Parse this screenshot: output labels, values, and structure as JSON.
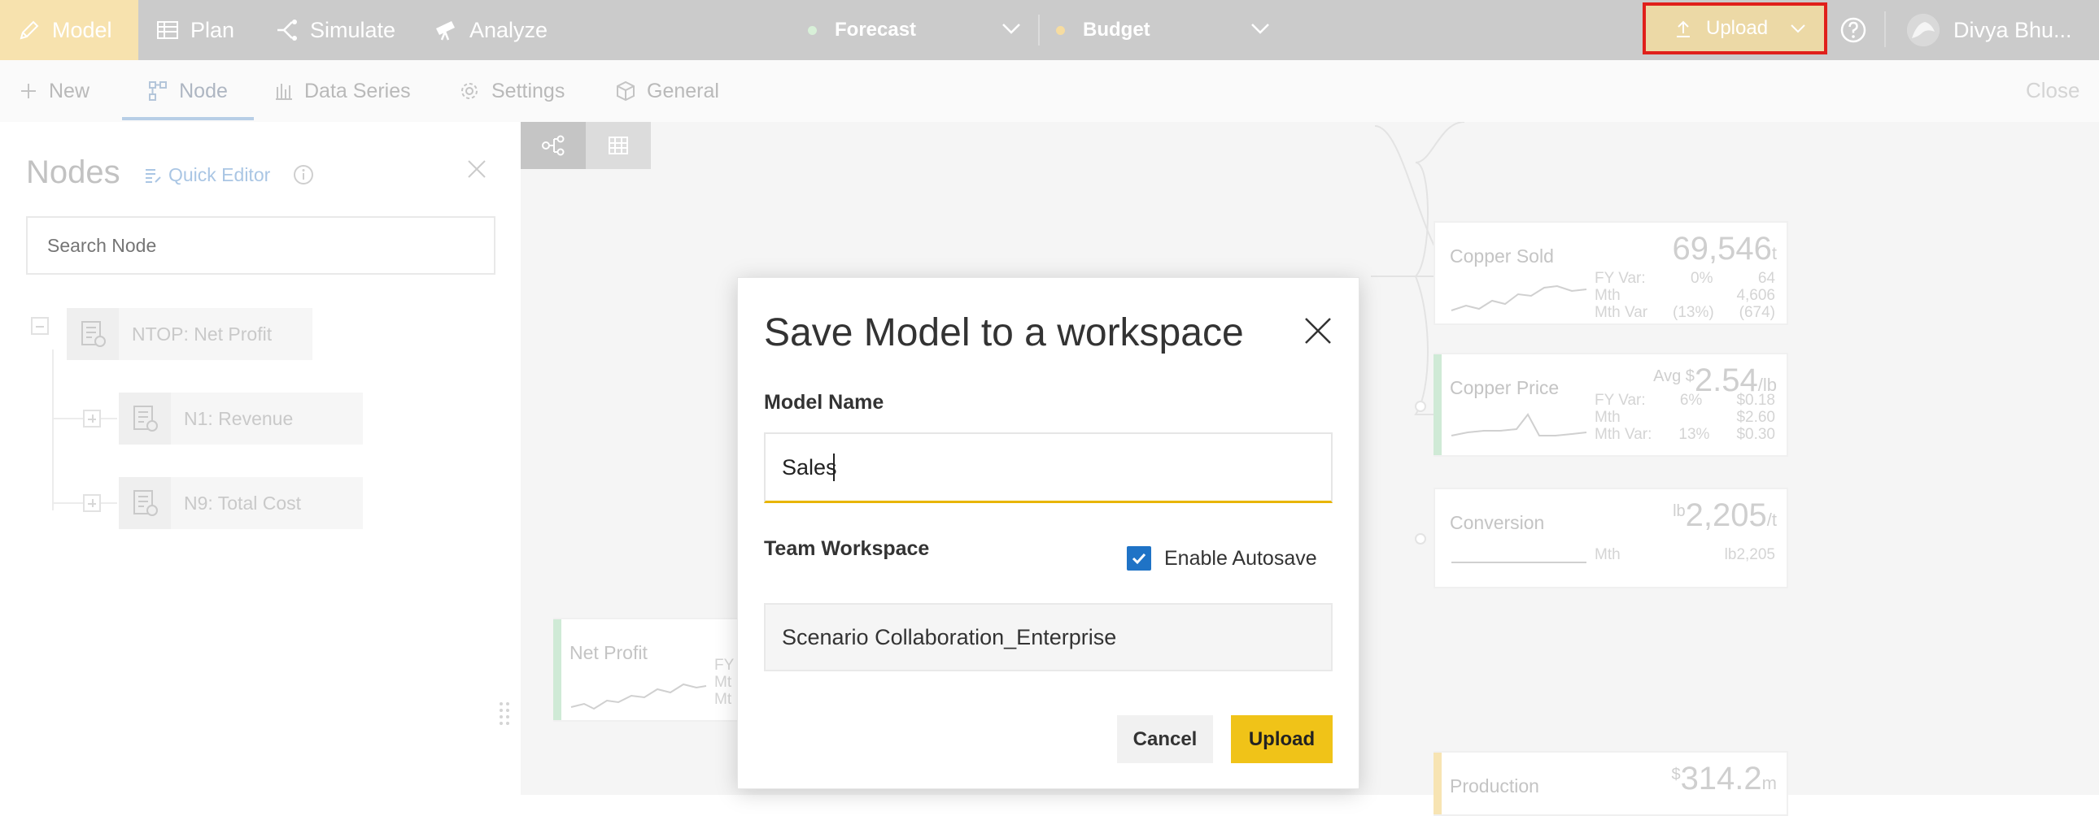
{
  "topbar": {
    "tabs": [
      {
        "label": "Model",
        "icon": "pencil-icon"
      },
      {
        "label": "Plan",
        "icon": "table-icon"
      },
      {
        "label": "Simulate",
        "icon": "branch-icon"
      },
      {
        "label": "Analyze",
        "icon": "telescope-icon"
      }
    ],
    "scenarios": [
      {
        "label": "Forecast",
        "dot_color": "#d8f0d8"
      },
      {
        "label": "Budget",
        "dot_color": "#f6dca0"
      }
    ],
    "upload_label": "Upload",
    "user_name": "Divya Bhu...",
    "accent_color": "#f0c318",
    "highlight_color": "#e0201b"
  },
  "subbar": {
    "items": [
      {
        "label": "New",
        "icon": "plus-icon"
      },
      {
        "label": "Node",
        "icon": "node-icon"
      },
      {
        "label": "Data Series",
        "icon": "bar-chart-icon"
      },
      {
        "label": "Settings",
        "icon": "gear-icon"
      },
      {
        "label": "General",
        "icon": "cube-icon"
      }
    ],
    "close_label": "Close"
  },
  "left_panel": {
    "title": "Nodes",
    "quick_editor": "Quick Editor",
    "search_placeholder": "Search Node",
    "tree": [
      {
        "label": "NTOP: Net Profit"
      },
      {
        "label": "N1: Revenue"
      },
      {
        "label": "N9: Total Cost"
      }
    ]
  },
  "canvas": {
    "cards": [
      {
        "name": "Copper Sold",
        "value": "69,546",
        "unit": "t",
        "prefix": "",
        "stats": [
          [
            "FY Var:",
            "0%",
            "64"
          ],
          [
            "Mth",
            "",
            "4,606"
          ],
          [
            "Mth Var",
            "(13%)",
            "(674)"
          ]
        ]
      },
      {
        "name": "Copper Price",
        "value": "2.54",
        "unit": "/lb",
        "prefix": "Avg $",
        "stats": [
          [
            "FY Var:",
            "6%",
            "$0.18"
          ],
          [
            "Mth",
            "",
            "$2.60"
          ],
          [
            "Mth Var:",
            "13%",
            "$0.30"
          ]
        ]
      },
      {
        "name": "Conversion",
        "value": "2,205",
        "unit": "/t",
        "prefix": "lb",
        "stats": [
          [
            "Mth",
            "",
            "lb2,205"
          ]
        ]
      },
      {
        "name": "Net Profit",
        "value": "",
        "unit": "",
        "prefix": "",
        "stats": [
          [
            "FY",
            "",
            ""
          ],
          [
            "Mt",
            "",
            ""
          ],
          [
            "Mt",
            "",
            ""
          ]
        ]
      },
      {
        "name": "Production",
        "value": "314.2",
        "unit": "m",
        "prefix": "$",
        "stats": []
      }
    ]
  },
  "dialog": {
    "title": "Save Model to a workspace",
    "model_name_label": "Model Name",
    "model_name_value": "Sales",
    "team_workspace_label": "Team Workspace",
    "autosave_label": "Enable Autosave",
    "autosave_checked": true,
    "workspace_value": "Scenario Collaboration_Enterprise",
    "cancel_label": "Cancel",
    "upload_label": "Upload"
  }
}
